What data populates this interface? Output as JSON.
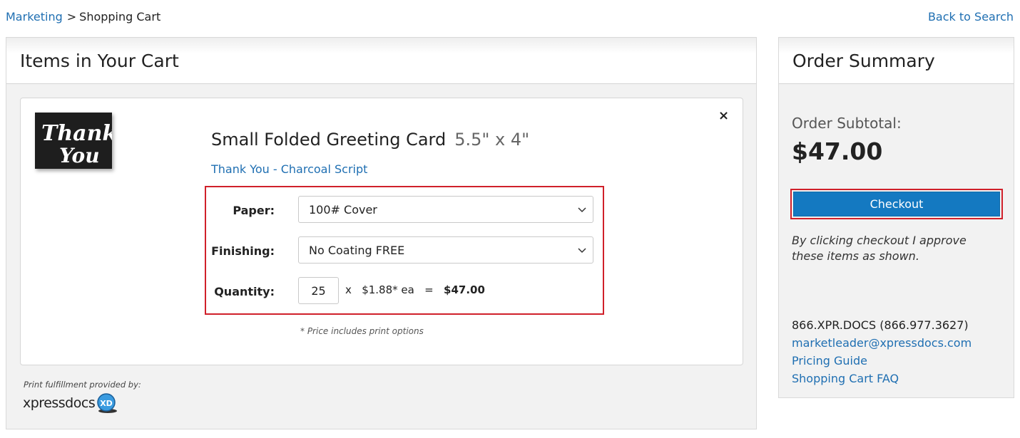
{
  "breadcrumb": {
    "parent": "Marketing",
    "separator": ">",
    "current": "Shopping Cart"
  },
  "back_link": "Back to Search",
  "cart": {
    "heading": "Items in Your Cart",
    "item": {
      "thumbnail_text": [
        "Thank",
        "You"
      ],
      "title": "Small Folded Greeting Card",
      "size": "5.5\" x 4\"",
      "design_link": "Thank You - Charcoal Script",
      "remove_symbol": "×",
      "options": {
        "paper_label": "Paper:",
        "paper_value": "100# Cover",
        "finishing_label": "Finishing:",
        "finishing_value": "No Coating FREE",
        "quantity_label": "Quantity:",
        "quantity_value": "25",
        "multiply": "x",
        "unit_price": "$1.88* ea",
        "equals": "=",
        "line_total": "$47.00"
      },
      "price_note": "* Price includes print options"
    },
    "fulfillment_note": "Print fulfillment provided by:",
    "provider_name": "xpressdocs",
    "provider_badge": "XD"
  },
  "summary": {
    "heading": "Order Summary",
    "subtotal_label": "Order Subtotal:",
    "subtotal_value": "$47.00",
    "checkout_label": "Checkout",
    "approve_note": "By clicking checkout I approve these items as shown.",
    "phone": "866.XPR.DOCS (866.977.3627)",
    "email": "marketleader@xpressdocs.com",
    "pricing_link": "Pricing Guide",
    "faq_link": "Shopping Cart FAQ"
  },
  "colors": {
    "link": "#1f6fb2",
    "checkout": "#1479c1",
    "highlight": "#d0202a"
  },
  "icons": [
    "chevron-down-icon",
    "close-icon",
    "xpressdocs-logo-icon"
  ]
}
